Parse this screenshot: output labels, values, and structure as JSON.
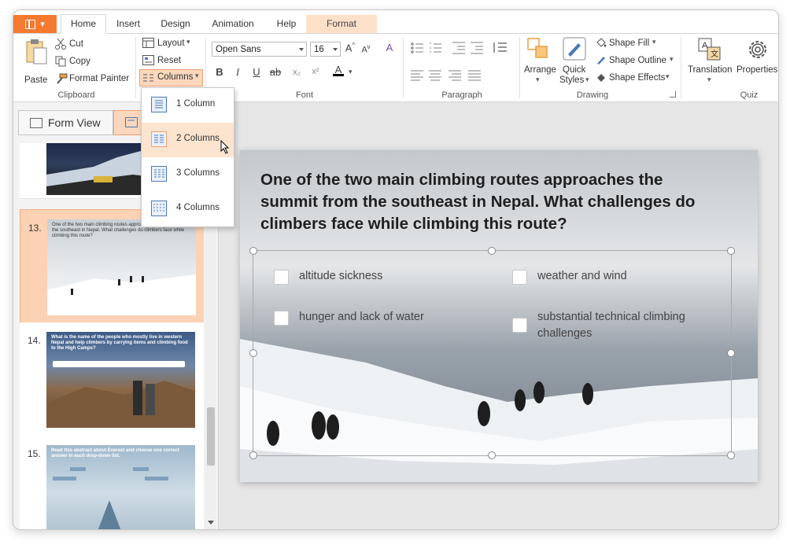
{
  "tabs": {
    "app_menu": "",
    "home": "Home",
    "insert": "Insert",
    "design": "Design",
    "animation": "Animation",
    "help": "Help",
    "format": "Format"
  },
  "clipboard": {
    "paste": "Paste",
    "cut": "Cut",
    "copy": "Copy",
    "format_painter": "Format Painter",
    "group": "Clipboard"
  },
  "slides_group": {
    "layout": "Layout",
    "reset": "Reset",
    "columns": "Columns"
  },
  "font": {
    "family": "Open Sans",
    "size": "16",
    "bold": "B",
    "italic": "I",
    "underline": "U",
    "strike": "ab",
    "group": "Font"
  },
  "paragraph": {
    "group": "Paragraph"
  },
  "drawing": {
    "arrange": "Arrange",
    "quick_styles_1": "Quick",
    "quick_styles_2": "Styles",
    "shape_fill": "Shape Fill",
    "shape_outline": "Shape Outline",
    "shape_effects": "Shape Effects",
    "group": "Drawing"
  },
  "quiz": {
    "translation": "Translation",
    "properties": "Properties",
    "group": "Quiz"
  },
  "view": {
    "form_view": "Form View"
  },
  "columns_menu": {
    "items": [
      "1 Column",
      "2 Columns",
      "3 Columns",
      "4 Columns"
    ]
  },
  "thumbnails": [
    {
      "number": "13.",
      "text": "One of the two main climbing routes approaches the summit from the southeast in Nepal. What challenges do climbers face while climbing this route?"
    },
    {
      "number": "14.",
      "text": "What is the name of the people who mostly live in western Nepal and help climbers by carrying items and climbing food to the High Camps?"
    },
    {
      "number": "15.",
      "text": "Read this abstract about Everest and choose one correct answer in each drop-down list."
    }
  ],
  "slide": {
    "question": "One of the two main climbing routes approaches the summit from the southeast in Nepal. What challenges do climbers face while climbing this route?",
    "options": [
      "altitude sickness",
      "weather and wind",
      "hunger and lack of water",
      "substantial technical climbing challenges"
    ]
  },
  "colors": {
    "accent": "#f5792f",
    "selected_bg": "#fbd2b4",
    "hover_bg": "#fde4cf"
  }
}
